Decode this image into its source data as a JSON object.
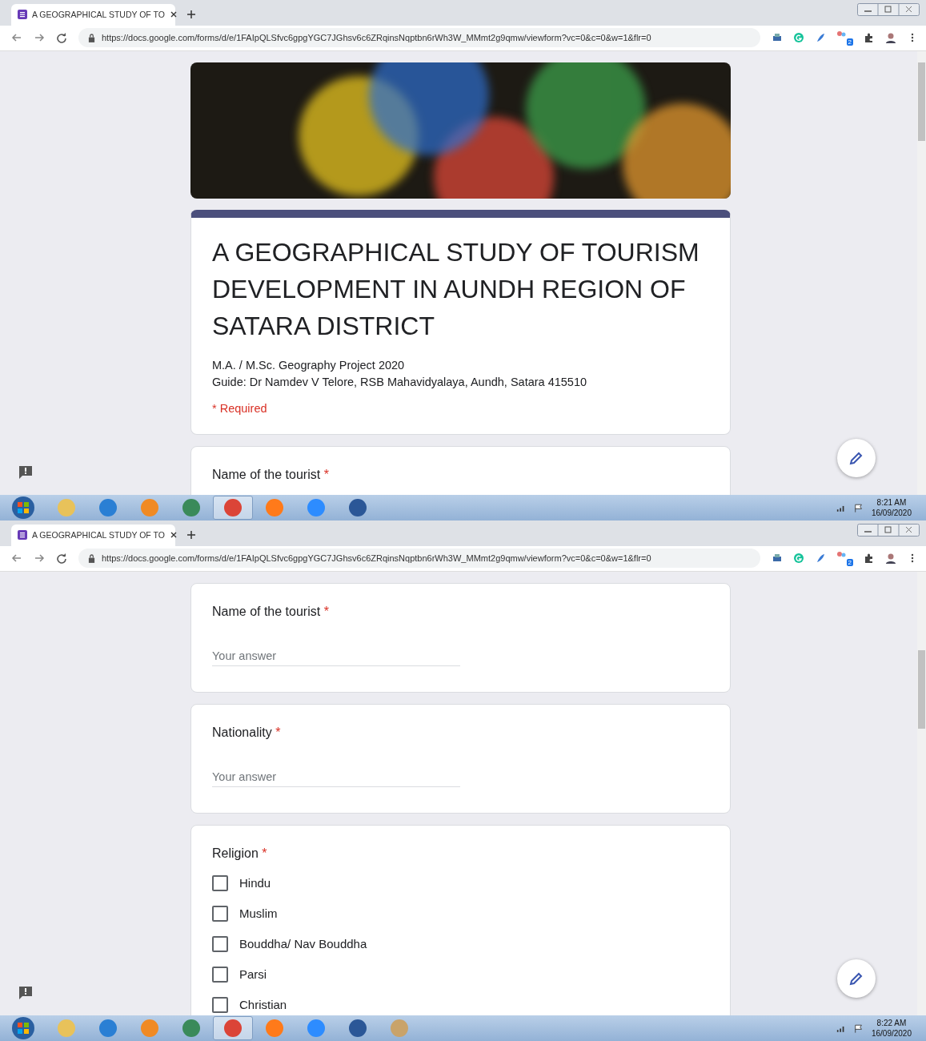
{
  "screens": [
    {
      "browser": {
        "tab_title": "A GEOGRAPHICAL STUDY OF TO",
        "url": "https://docs.google.com/forms/d/e/1FAIpQLSfvc6gpgYGC7JGhsv6c6ZRqinsNqptbn6rWh3W_MMmt2g9qmw/viewform?vc=0&c=0&w=1&flr=0",
        "extension_badge": "2"
      },
      "form": {
        "header_image": true,
        "title": "A GEOGRAPHICAL STUDY OF TOURISM DEVELOPMENT IN AUNDH REGION OF SATARA DISTRICT",
        "description": [
          "M.A. / M.Sc. Geography Project 2020",
          "Guide: Dr Namdev V Telore, RSB Mahavidyalaya, Aundh, Satara 415510"
        ],
        "required_note": "* Required",
        "questions": [
          {
            "kind": "text",
            "title": "Name of the tourist",
            "required_mark": "*"
          }
        ]
      },
      "taskbar": {
        "apps": [
          {
            "kind": "explorer",
            "selected": false
          },
          {
            "kind": "ie",
            "selected": false
          },
          {
            "kind": "media",
            "selected": false
          },
          {
            "kind": "magnifier",
            "selected": false
          },
          {
            "kind": "chrome",
            "selected": true
          },
          {
            "kind": "firefox",
            "selected": false
          },
          {
            "kind": "zoom",
            "selected": false
          },
          {
            "kind": "word",
            "selected": false
          }
        ],
        "time": "8:21 AM",
        "date": "16/09/2020"
      }
    },
    {
      "browser": {
        "tab_title": "A GEOGRAPHICAL STUDY OF TO",
        "url": "https://docs.google.com/forms/d/e/1FAIpQLSfvc6gpgYGC7JGhsv6c6ZRqinsNqptbn6rWh3W_MMmt2g9qmw/viewform?vc=0&c=0&w=1&flr=0",
        "extension_badge": "2"
      },
      "form": {
        "questions": [
          {
            "kind": "text",
            "title": "Name of the tourist",
            "required_mark": "*",
            "placeholder": "Your answer"
          },
          {
            "kind": "text",
            "title": "Nationality",
            "required_mark": "*",
            "placeholder": "Your answer"
          },
          {
            "kind": "checkbox",
            "title": "Religion",
            "required_mark": "*",
            "options": [
              {
                "label": "Hindu",
                "checked": false
              },
              {
                "label": "Muslim",
                "checked": false
              },
              {
                "label": "Bouddha/ Nav Bouddha",
                "checked": false
              },
              {
                "label": "Parsi",
                "checked": false
              },
              {
                "label": "Christian",
                "checked": false
              }
            ]
          }
        ]
      },
      "taskbar": {
        "apps": [
          {
            "kind": "explorer",
            "selected": false
          },
          {
            "kind": "ie",
            "selected": false
          },
          {
            "kind": "media",
            "selected": false
          },
          {
            "kind": "magnifier",
            "selected": false
          },
          {
            "kind": "chrome",
            "selected": true
          },
          {
            "kind": "firefox",
            "selected": false
          },
          {
            "kind": "zoom",
            "selected": false
          },
          {
            "kind": "word",
            "selected": false
          },
          {
            "kind": "paint",
            "selected": false
          }
        ],
        "time": "8:22 AM",
        "date": "16/09/2020"
      }
    }
  ]
}
